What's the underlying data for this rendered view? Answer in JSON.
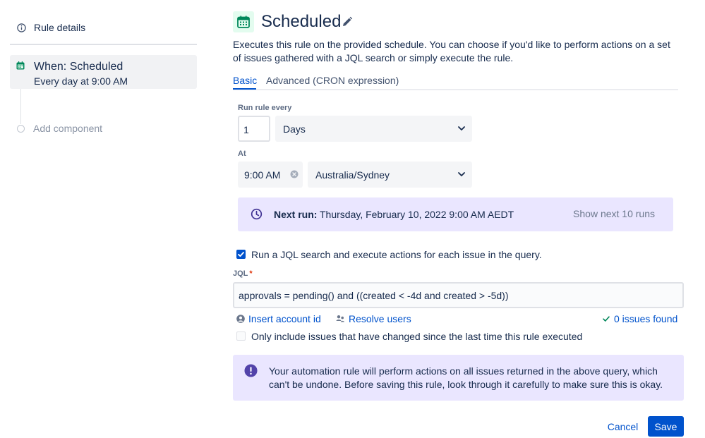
{
  "sidebar": {
    "rule_details_label": "Rule details",
    "trigger": {
      "title": "When: Scheduled",
      "subtitle": "Every day at 9:00 AM"
    },
    "add_component_label": "Add component"
  },
  "header": {
    "title": "Scheduled",
    "description": "Executes this rule on the provided schedule. You can choose if you'd like to perform actions on a set of issues gathered with a JQL search or simply execute the rule."
  },
  "tabs": [
    {
      "label": "Basic",
      "active": true
    },
    {
      "label": "Advanced (CRON expression)",
      "active": false
    }
  ],
  "form": {
    "run_every_label": "Run rule every",
    "run_every_value": "1",
    "run_every_unit": "Days",
    "at_label": "At",
    "time_value": "9:00 AM",
    "timezone": "Australia/Sydney"
  },
  "next_run": {
    "label": "Next run:",
    "value": "Thursday, February 10, 2022 9:00 AM AEDT",
    "show_next_label": "Show next 10 runs"
  },
  "jql_option": {
    "checked": true,
    "label": "Run a JQL search and execute actions for each issue in the query."
  },
  "jql": {
    "label": "JQL",
    "required_marker": "*",
    "value": "approvals = pending() and ((created < -4d and created > -5d))",
    "insert_account_label": "Insert account id",
    "resolve_users_label": "Resolve users",
    "issues_found_label": "0 issues found"
  },
  "only_changed": {
    "checked": false,
    "label": "Only include issues that have changed since the last time this rule executed"
  },
  "warning": {
    "text": "Your automation rule will perform actions on all issues returned in the above query, which can't be undone. Before saving this rule, look through it carefully to make sure this is okay."
  },
  "buttons": {
    "cancel": "Cancel",
    "save": "Save"
  },
  "colors": {
    "accent": "#0052cc",
    "calendar_icon": "#00875a",
    "info_panel_bg": "#eae6ff",
    "warning_icon": "#5243aa",
    "success_check": "#00875a"
  },
  "icons": {
    "info": "info-icon",
    "calendar": "calendar-icon",
    "edit": "pencil-icon",
    "chevron": "chevron-down-icon",
    "clear": "clear-icon",
    "clock": "clock-icon",
    "person": "person-icon",
    "people": "people-icon",
    "check": "check-icon",
    "warning": "exclamation-icon"
  }
}
